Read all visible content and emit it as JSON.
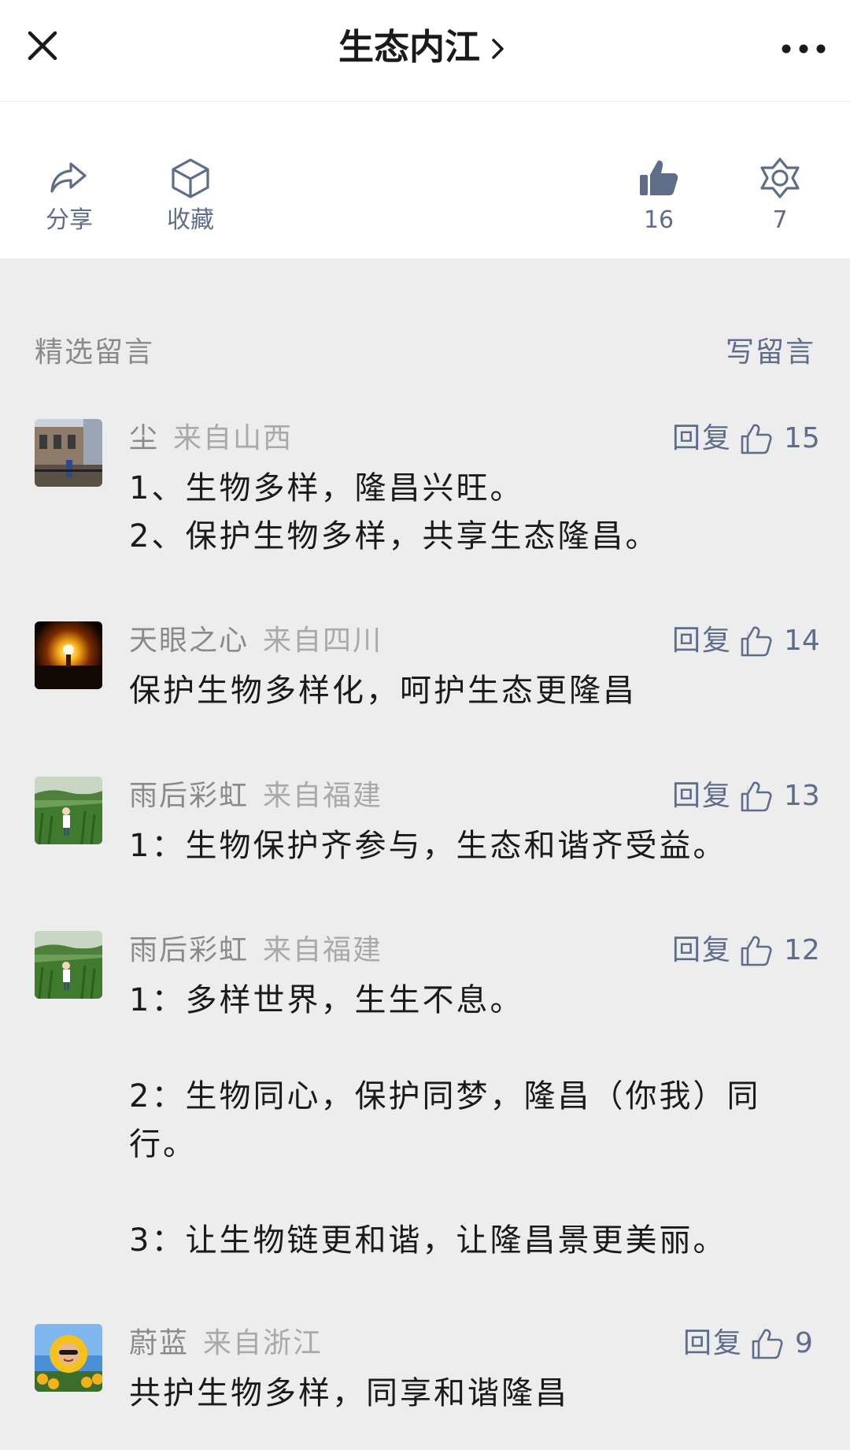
{
  "nav": {
    "title": "生态内江",
    "close_icon": "close-icon",
    "more_icon": "more-icon",
    "chevron_icon": "chevron-right-icon"
  },
  "actions": {
    "share_label": "分享",
    "favorite_label": "收藏",
    "like_count": "16",
    "wow_count": "7"
  },
  "comments_section": {
    "title": "精选留言",
    "write_label": "写留言"
  },
  "colors": {
    "accent": "#5e6d8a",
    "background": "#ededed",
    "text": "#1a1a1a",
    "muted": "#8a8a8a"
  },
  "comments": [
    {
      "nickname": "尘",
      "location": "来自山西",
      "reply_label": "回复",
      "likes": "15",
      "text": "1、生物多样，隆昌兴旺。\n2、保护生物多样，共享生态隆昌。"
    },
    {
      "nickname": "天眼之心",
      "location": "来自四川",
      "reply_label": "回复",
      "likes": "14",
      "text": "保护生物多样化，呵护生态更隆昌"
    },
    {
      "nickname": "雨后彩虹",
      "location": "来自福建",
      "reply_label": "回复",
      "likes": "13",
      "text": "1：生物保护齐参与，生态和谐齐受益。"
    },
    {
      "nickname": "雨后彩虹",
      "location": "来自福建",
      "reply_label": "回复",
      "likes": "12",
      "text": "1：多样世界，生生不息。\n\n2：生物同心，保护同梦，隆昌（你我）同行。\n\n3：让生物链更和谐，让隆昌景更美丽。"
    },
    {
      "nickname": "蔚蓝",
      "location": "来自浙江",
      "reply_label": "回复",
      "likes": "9",
      "text": "共护生物多样，同享和谐隆昌"
    }
  ]
}
